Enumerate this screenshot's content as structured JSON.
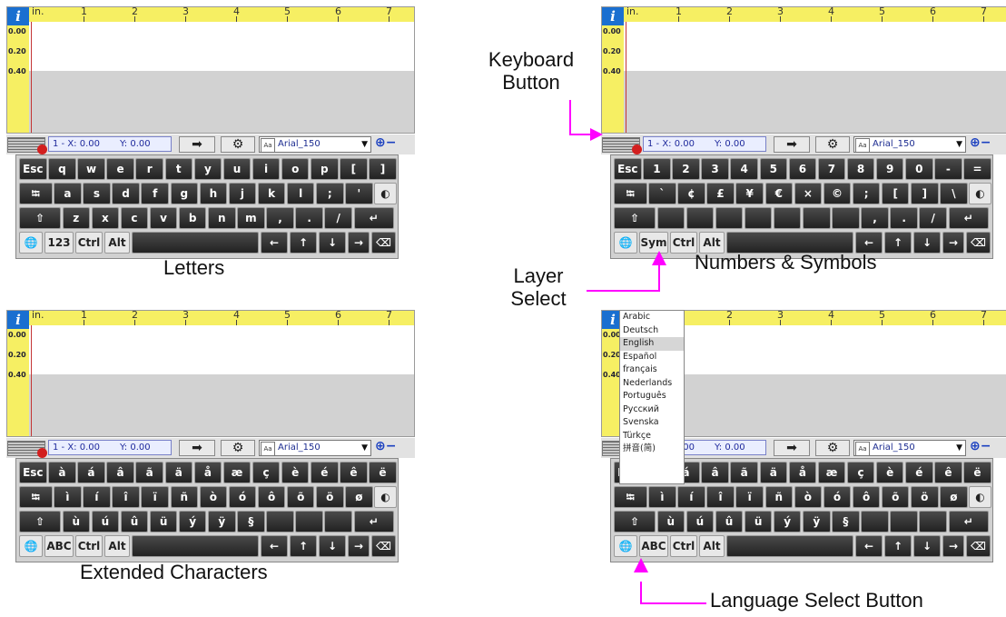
{
  "editor": {
    "info_label": "i",
    "ruler_unit": "in.",
    "ruler_numbers": [
      "1",
      "2",
      "3",
      "4",
      "5",
      "6",
      "7"
    ],
    "vertical_ruler": [
      "0.00",
      "0.20",
      "0.40"
    ],
    "x_readout": "1 - X: 0.00",
    "y_readout": "Y: 0.00",
    "font_name": "Arial_150",
    "aa_label": "Aa"
  },
  "captions": {
    "letters": "Letters",
    "numbers": "Numbers & Symbols",
    "extended": "Extended Characters"
  },
  "annotations": {
    "keyboard_button": "Keyboard Button",
    "layer_select": "Layer Select",
    "language_select": "Language Select Button"
  },
  "colors": {
    "annotation_arrow": "#ff00ff",
    "ruler": "#f6ef63",
    "info": "#1a6fd0"
  },
  "keyboards": {
    "letters": {
      "row1": [
        "Esc",
        "q",
        "w",
        "e",
        "r",
        "t",
        "y",
        "u",
        "i",
        "o",
        "p",
        "[",
        "]"
      ],
      "row2": [
        "⭾",
        "a",
        "s",
        "d",
        "f",
        "g",
        "h",
        "j",
        "k",
        "l",
        ";",
        "'",
        "◐"
      ],
      "row3": [
        "⇧",
        "z",
        "x",
        "c",
        "v",
        "b",
        "n",
        "m",
        ",",
        ".",
        "/",
        "↵"
      ],
      "row4": [
        "🌐",
        "123",
        "Ctrl",
        "Alt",
        "",
        "←",
        "↑",
        "↓",
        "→",
        "⌫"
      ]
    },
    "numbers": {
      "row1": [
        "Esc",
        "1",
        "2",
        "3",
        "4",
        "5",
        "6",
        "7",
        "8",
        "9",
        "0",
        "-",
        "="
      ],
      "row2": [
        "⭾",
        "`",
        "¢",
        "£",
        "¥",
        "€",
        "×",
        "©",
        ";",
        "[",
        "]",
        "\\",
        "◐"
      ],
      "row3": [
        "⇧",
        "",
        "",
        "",
        "",
        "",
        "",
        "",
        ",",
        ".",
        "/",
        "↵"
      ],
      "row4": [
        "🌐",
        "Sym",
        "Ctrl",
        "Alt",
        "",
        "←",
        "↑",
        "↓",
        "→",
        "⌫"
      ]
    },
    "extended": {
      "row1": [
        "Esc",
        "à",
        "á",
        "â",
        "ã",
        "ä",
        "å",
        "æ",
        "ç",
        "è",
        "é",
        "ê",
        "ë"
      ],
      "row2": [
        "⭾",
        "ì",
        "í",
        "î",
        "ï",
        "ñ",
        "ò",
        "ó",
        "ô",
        "õ",
        "ö",
        "ø",
        "◐"
      ],
      "row3": [
        "⇧",
        "ù",
        "ú",
        "û",
        "ü",
        "ý",
        "ÿ",
        "§",
        "",
        "",
        "",
        "↵"
      ],
      "row4": [
        "🌐",
        "ABC",
        "Ctrl",
        "Alt",
        "",
        "←",
        "↑",
        "↓",
        "→",
        "⌫"
      ]
    }
  },
  "languages": [
    "Arabic",
    "Deutsch",
    "English",
    "Español",
    "français",
    "Nederlands",
    "Português",
    "Русский",
    "Svenska",
    "Türkçe",
    "拼音(简)"
  ],
  "selected_language": "English"
}
